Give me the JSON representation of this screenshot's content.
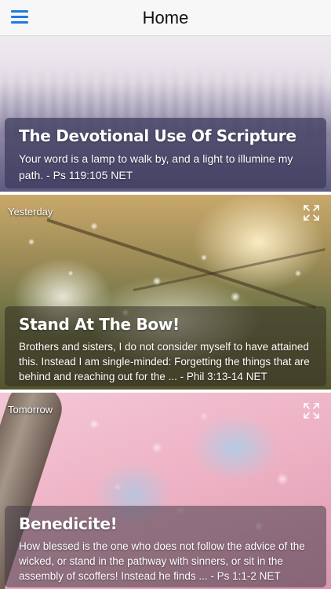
{
  "nav": {
    "title": "Home",
    "menu_icon": "hamburger-menu-icon",
    "accent": "#1e7be0"
  },
  "cards": [
    {
      "day_label": "",
      "title": "The Devotional Use Of Scripture",
      "text": "Your word is a lamp to walk by, and a light to illumine my path. - Ps 119:105 NET"
    },
    {
      "day_label": "Yesterday",
      "title": "Stand At The Bow!",
      "text": "Brothers and sisters, I do not consider myself to have attained this. Instead I am single-minded: Forgetting the things that are behind and reaching out for the ... - Phil 3:13-14 NET",
      "expand_icon": "expand-icon"
    },
    {
      "day_label": "Tomorrow",
      "title": "Benedicite!",
      "text": "How blessed is the one who does not follow the advice of the wicked, or stand in the pathway with sinners, or sit in the assembly of scoffers! Instead he finds ... - Ps 1:1-2 NET",
      "expand_icon": "expand-icon"
    }
  ]
}
